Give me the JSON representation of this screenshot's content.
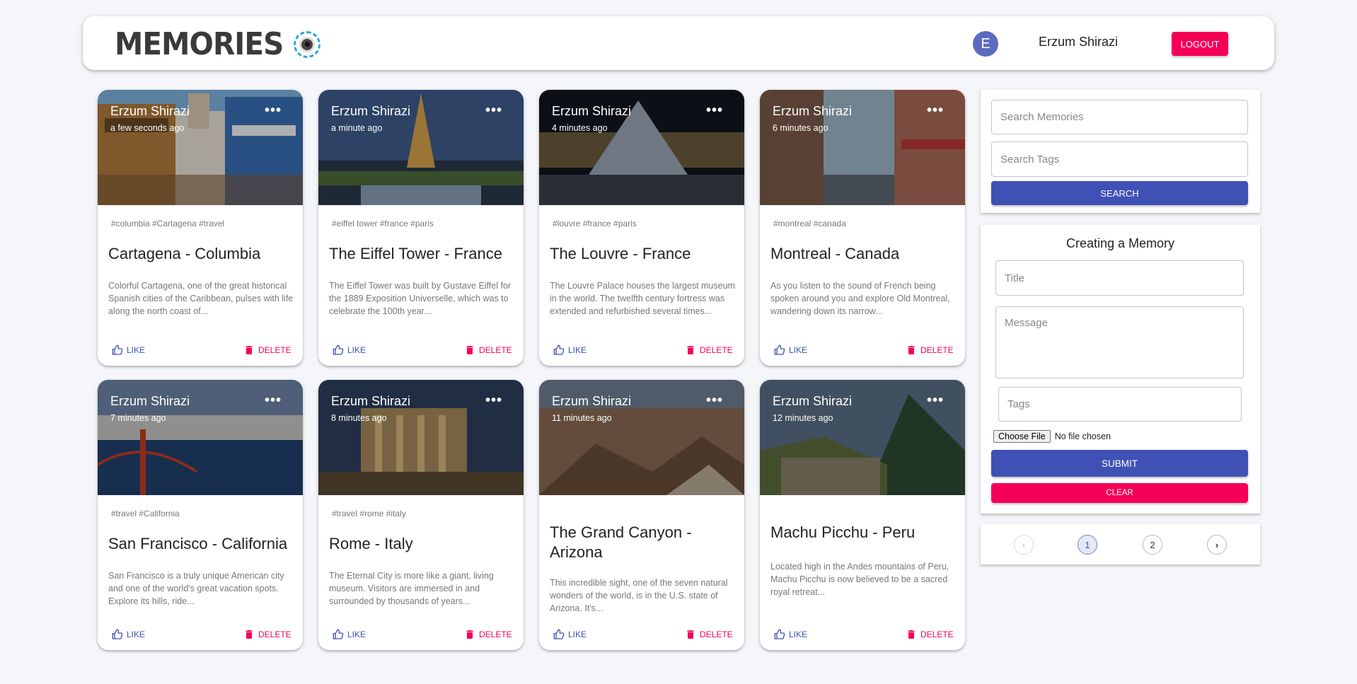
{
  "header": {
    "brand": "Memories",
    "avatar_initial": "E",
    "user_name": "Erzum Shirazi",
    "logout_label": "LOGOUT"
  },
  "posts": [
    {
      "author": "Erzum Shirazi",
      "time": "a few seconds ago",
      "tags": "#columbia #Cartagena #travel",
      "title": "Cartagena - Columbia",
      "message": "Colorful Cartagena, one of the great historical Spanish cities of the Caribbean, pulses with life along the north coast of...",
      "like_label": "LIKE",
      "delete_label": "DELETE"
    },
    {
      "author": "Erzum Shirazi",
      "time": "a minute ago",
      "tags": "#eiffel tower #france #paris",
      "title": "The Eiffel Tower - France",
      "message": "The Eiffel Tower was built by Gustave Eiffel for the 1889 Exposition Universelle, which was to celebrate the 100th year...",
      "like_label": "LIKE",
      "delete_label": "DELETE"
    },
    {
      "author": "Erzum Shirazi",
      "time": "4 minutes ago",
      "tags": "#louvre #france #paris",
      "title": "The Louvre - France",
      "message": "The Louvre Palace houses the largest museum in the world. The twelfth century fortress was extended and refurbished several times...",
      "like_label": "LIKE",
      "delete_label": "DELETE"
    },
    {
      "author": "Erzum Shirazi",
      "time": "6 minutes ago",
      "tags": "#montreal #canada",
      "title": "Montreal - Canada",
      "message": "As you listen to the sound of French being spoken around you and explore Old Montreal, wandering down its narrow...",
      "like_label": "LIKE",
      "delete_label": "DELETE"
    },
    {
      "author": "Erzum Shirazi",
      "time": "7 minutes ago",
      "tags": "#travel #California",
      "title": "San Francisco - California",
      "message": "San Francisco is a truly unique American city and one of the world's great vacation spots. Explore its hills, ride...",
      "like_label": "LIKE",
      "delete_label": "DELETE"
    },
    {
      "author": "Erzum Shirazi",
      "time": "8 minutes ago",
      "tags": "#travel #rome #italy",
      "title": "Rome - Italy",
      "message": "The Eternal City is more like a giant, living museum. Visitors are immersed in and surrounded by thousands of years...",
      "like_label": "LIKE",
      "delete_label": "DELETE"
    },
    {
      "author": "Erzum Shirazi",
      "time": "11 minutes ago",
      "tags": "",
      "title": "The Grand Canyon - Arizona",
      "message": "This incredible sight, one of the seven natural wonders of the world, is in the U.S. state of Arizona. It's...",
      "like_label": "LIKE",
      "delete_label": "DELETE"
    },
    {
      "author": "Erzum Shirazi",
      "time": "12 minutes ago",
      "tags": "",
      "title": "Machu Picchu - Peru",
      "message": "Located high in the Andes mountains of Peru, Machu Picchu is now believed to be a sacred royal retreat...",
      "like_label": "LIKE",
      "delete_label": "DELETE"
    }
  ],
  "search": {
    "memories_placeholder": "Search Memories",
    "tags_placeholder": "Search Tags",
    "button_label": "SEARCH"
  },
  "form": {
    "title": "Creating a Memory",
    "title_placeholder": "Title",
    "message_placeholder": "Message",
    "tags_placeholder": "Tags",
    "choose_file_label": "Choose File",
    "no_file_label": "No file chosen",
    "submit_label": "SUBMIT",
    "clear_label": "CLEAR"
  },
  "pagination": {
    "pages": [
      "1",
      "2"
    ],
    "current": "1",
    "prev_icon": "chevron-left-icon",
    "next_icon": "chevron-right-icon"
  },
  "colors": {
    "primary": "#3f51b5",
    "secondary": "#f50057",
    "avatar": "#5c6bc0",
    "background": "#f5f6fa"
  }
}
